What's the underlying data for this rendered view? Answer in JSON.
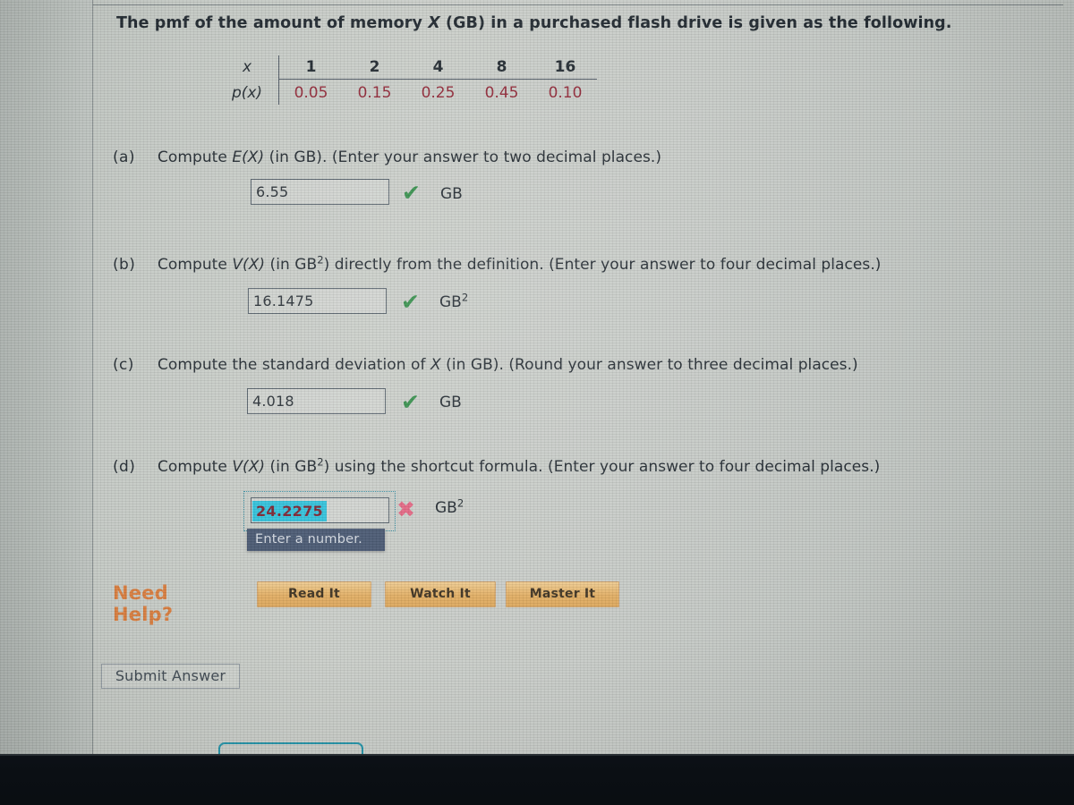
{
  "problem": {
    "stem_before": "The pmf of the amount of memory ",
    "stem_var": "X",
    "stem_after": " (GB) in a purchased flash drive is given as the following."
  },
  "pmf_table": {
    "row_header_x": "x",
    "row_header_p": "p(x)",
    "x_values": [
      "1",
      "2",
      "4",
      "8",
      "16"
    ],
    "p_values": [
      "0.05",
      "0.15",
      "0.25",
      "0.45",
      "0.10"
    ],
    "p_value_color": "#8e2232"
  },
  "parts": [
    {
      "label": "(a)",
      "text_a": "Compute ",
      "text_var": "E(X)",
      "text_b": " (in GB). (Enter your answer to two decimal places.)",
      "answer_value": "6.55",
      "status": "correct",
      "status_glyph": "✔",
      "unit": "GB",
      "unit_exponent": ""
    },
    {
      "label": "(b)",
      "text_a": "Compute ",
      "text_var": "V(X)",
      "text_b": " (in GB²) directly from the definition. (Enter your answer to four decimal places.)",
      "answer_value": "16.1475",
      "status": "correct",
      "status_glyph": "✔",
      "unit": "GB",
      "unit_exponent": "2"
    },
    {
      "label": "(c)",
      "text_a": "Compute the standard deviation of ",
      "text_var": "X",
      "text_b": " (in GB). (Round your answer to three decimal places.)",
      "answer_value": "4.018",
      "status": "correct",
      "status_glyph": "✔",
      "unit": "GB",
      "unit_exponent": ""
    },
    {
      "label": "(d)",
      "text_a": "Compute ",
      "text_var": "V(X)",
      "text_b": " (in GB²) using the shortcut formula. (Enter your answer to four decimal places.)",
      "answer_value": "24.2275",
      "status": "incorrect",
      "status_glyph": "✖",
      "unit": "GB",
      "unit_exponent": "2",
      "validation_message": "Enter a number.",
      "selection_color": "#2cc0da"
    }
  ],
  "need_help": {
    "label": "Need Help?",
    "label_color": "#d77a3a",
    "buttons": [
      {
        "label": "Read It"
      },
      {
        "label": "Watch It"
      },
      {
        "label": "Master It"
      }
    ]
  },
  "submit": {
    "label": "Submit Answer"
  },
  "status_colors": {
    "correct": "#2e8b45",
    "incorrect": "#e2617f"
  }
}
